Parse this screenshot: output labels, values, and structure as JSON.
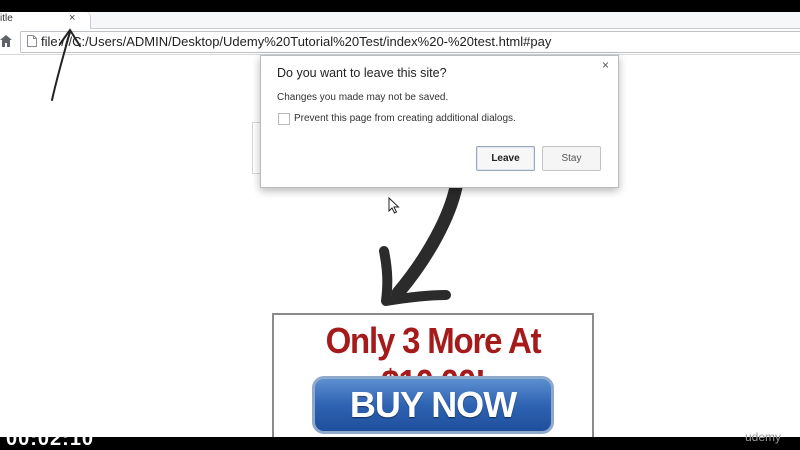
{
  "browser": {
    "tab": {
      "title": "itle",
      "close_glyph": "×"
    },
    "address_bar": {
      "url": "file:///C:/Users/ADMIN/Desktop/Udemy%20Tutorial%20Test/index%20-%20test.html#pay"
    },
    "icons": {
      "home": "home-icon",
      "page": "page-icon"
    }
  },
  "dialog": {
    "title": "Do you want to leave this site?",
    "message": "Changes you made may not be saved.",
    "checkbox_label": "Prevent this page from creating additional dialogs.",
    "checkbox_checked": false,
    "leave_label": "Leave",
    "stay_label": "Stay",
    "close_glyph": "×"
  },
  "promo": {
    "headline": "Only 3 More At $10.00!",
    "button_label": "BUY NOW"
  },
  "overlay": {
    "timecode": "00:02:10",
    "watermark": "udemy"
  },
  "colors": {
    "headline_red": "#a51a1b",
    "button_blue": "#2e63b3"
  }
}
